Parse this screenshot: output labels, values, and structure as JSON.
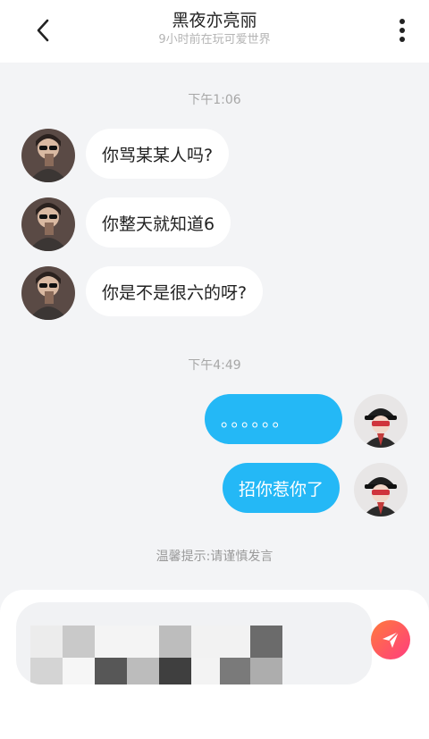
{
  "header": {
    "title": "黑夜亦亮丽",
    "subtitle": "9小时前在玩可爱世界"
  },
  "chat": {
    "time1": "下午1:06",
    "time2": "下午4:49",
    "incoming": [
      {
        "text": "你骂某某人吗?"
      },
      {
        "text": "你整天就知道6"
      },
      {
        "text": "你是不是很六的呀?"
      }
    ],
    "outgoing": [
      {
        "text": "。。。。。。"
      },
      {
        "text": "招你惹你了"
      }
    ]
  },
  "tip": "温馨提示:请谨慎发言",
  "icons": {
    "back": "chevron-left-icon",
    "more": "more-vertical-icon",
    "send": "paper-plane-icon"
  },
  "colors": {
    "accent": "#24b8f6",
    "send_gradient_start": "#ff7a3c",
    "send_gradient_end": "#ff3d7f"
  }
}
